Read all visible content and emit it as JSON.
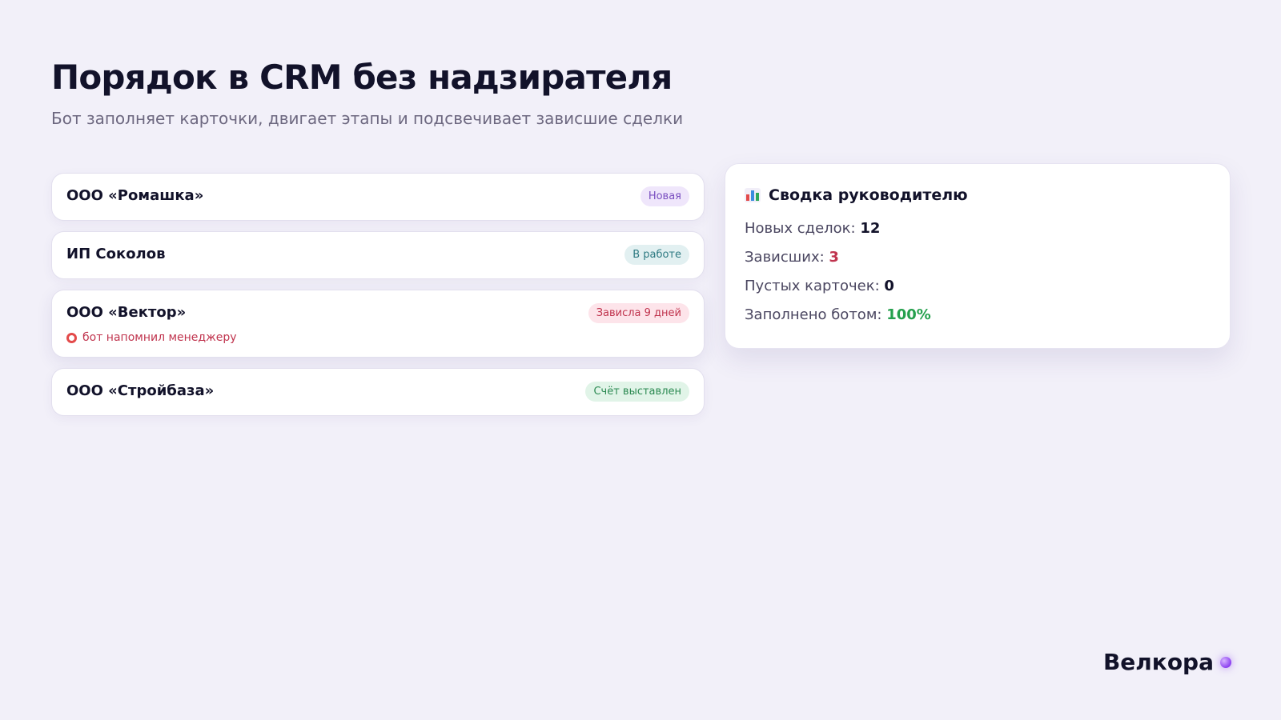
{
  "header": {
    "title": "Порядок в CRM без надзирателя",
    "subtitle": "Бот заполняет карточки, двигает этапы и подсвечивает зависшие сделки"
  },
  "deals": [
    {
      "name": "ООО «Ромашка»",
      "status": "Новая",
      "status_color": "#7a4fc0"
    },
    {
      "name": "ИП Соколов",
      "status": "В работе",
      "status_color": "#2e7a82"
    },
    {
      "name": "ООО «Вектор»",
      "status": "Зависла 9 дней",
      "status_color": "#c0344e",
      "note": "бот напомнил менеджеру",
      "note_icon": "alarm-clock-icon"
    },
    {
      "name": "ООО «Стройбаза»",
      "status": "Счёт выставлен",
      "status_color": "#2c8a52"
    }
  ],
  "summary": {
    "title": "Сводка руководителю",
    "icon": "bar-chart-icon",
    "stats": [
      {
        "label": "Новых сделок: ",
        "value": "12"
      },
      {
        "label": "Зависших: ",
        "value": "3",
        "color": "#c0344e"
      },
      {
        "label": "Пустых карточек: ",
        "value": "0"
      },
      {
        "label": "Заполнено ботом: ",
        "value": "100%",
        "color": "#25a04d"
      }
    ]
  },
  "brand": {
    "name": "Велкора",
    "accent": "#8b3ff0"
  }
}
